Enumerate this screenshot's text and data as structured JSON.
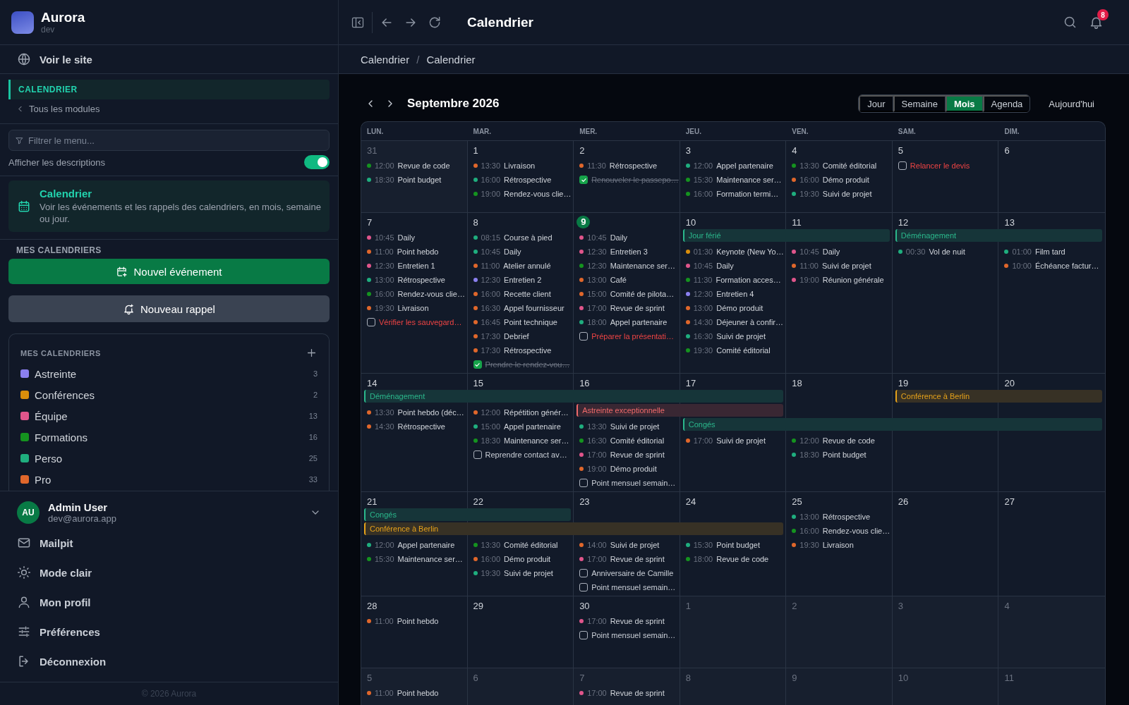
{
  "brand": {
    "name": "Aurora",
    "env": "dev"
  },
  "sidebar": {
    "site_link": "Voir le site",
    "module": "CALENDRIER",
    "back_link": "Tous les modules",
    "filter": {
      "placeholder": "Filtrer le menu..."
    },
    "descriptions_toggle": {
      "label": "Afficher les descriptions",
      "on": true
    },
    "info_card": {
      "title": "Calendrier",
      "text": "Voir les événements et les rappels des calendriers, en mois, semaine ou jour."
    },
    "section_title": "MES CALENDRIERS",
    "buttons": [
      {
        "kind": "primary",
        "label": "Nouvel événement"
      },
      {
        "kind": "secondary",
        "label": "Nouveau rappel"
      }
    ],
    "calendars": {
      "title": "MES CALENDRIERS",
      "items": [
        {
          "name": "Astreinte",
          "count": "3",
          "color": "#8b80f0"
        },
        {
          "name": "Conférences",
          "count": "2",
          "color": "#d98e0b"
        },
        {
          "name": "Équipe",
          "count": "13",
          "color": "#e0558b"
        },
        {
          "name": "Formations",
          "count": "16",
          "color": "#15931f"
        },
        {
          "name": "Perso",
          "count": "25",
          "color": "#1fae7e"
        },
        {
          "name": "Pro",
          "count": "33",
          "color": "#e0672b"
        }
      ]
    },
    "user": {
      "initials": "AU",
      "name": "Admin User",
      "email": "dev@aurora.app"
    },
    "menu": [
      {
        "kind": "mail",
        "label": "Mailpit"
      },
      {
        "kind": "sun",
        "label": "Mode clair"
      },
      {
        "kind": "user",
        "label": "Mon profil"
      },
      {
        "kind": "sliders",
        "label": "Préférences"
      },
      {
        "kind": "logout",
        "label": "Déconnexion"
      }
    ],
    "footer": "© 2026 Aurora"
  },
  "topbar": {
    "title": "Calendrier",
    "notifications": "8"
  },
  "breadcrumb": {
    "items": [
      "Calendrier",
      "Calendrier"
    ],
    "separator": "/"
  },
  "calendar": {
    "month": "Septembre 2026",
    "views": [
      {
        "label": "Jour",
        "selected": false
      },
      {
        "label": "Semaine",
        "selected": false
      },
      {
        "label": "Mois",
        "selected": true
      },
      {
        "label": "Agenda",
        "selected": false
      }
    ],
    "today_button": "Aujourd'hui",
    "weekdays": [
      "LUN.",
      "MAR.",
      "MER.",
      "JEU.",
      "VEN.",
      "SAM.",
      "DIM."
    ],
    "weeks": [
      {
        "days": [
          {
            "num": "31",
            "outside": true,
            "today": false,
            "items": [
              {
                "kind": "event",
                "time": "12:00",
                "title": "Revue de code",
                "color": "#15931f"
              },
              {
                "kind": "event",
                "time": "18:30",
                "title": "Point budget",
                "color": "#1fae7e"
              }
            ]
          },
          {
            "num": "1",
            "outside": false,
            "today": false,
            "items": [
              {
                "kind": "event",
                "time": "13:30",
                "title": "Livraison",
                "color": "#e0672b"
              },
              {
                "kind": "event",
                "time": "16:00",
                "title": "Rétrospective",
                "color": "#1fae7e"
              },
              {
                "kind": "event",
                "time": "19:00",
                "title": "Rendez-vous clie…",
                "color": "#15931f"
              }
            ]
          },
          {
            "num": "2",
            "outside": false,
            "today": false,
            "items": [
              {
                "kind": "event",
                "time": "11:30",
                "title": "Rétrospective",
                "color": "#e0672b"
              },
              {
                "kind": "task",
                "title": "Renouveler le passepo…",
                "checked": true,
                "overdue": false
              }
            ]
          },
          {
            "num": "3",
            "outside": false,
            "today": false,
            "items": [
              {
                "kind": "event",
                "time": "12:00",
                "title": "Appel partenaire",
                "color": "#1fae7e"
              },
              {
                "kind": "event",
                "time": "15:30",
                "title": "Maintenance ser…",
                "color": "#15931f"
              },
              {
                "kind": "event",
                "time": "16:00",
                "title": "Formation termi…",
                "color": "#15931f"
              }
            ]
          },
          {
            "num": "4",
            "outside": false,
            "today": false,
            "items": [
              {
                "kind": "event",
                "time": "13:30",
                "title": "Comité éditorial",
                "color": "#15931f"
              },
              {
                "kind": "event",
                "time": "16:00",
                "title": "Démo produit",
                "color": "#e0672b"
              },
              {
                "kind": "event",
                "time": "19:30",
                "title": "Suivi de projet",
                "color": "#1fae7e"
              }
            ]
          },
          {
            "num": "5",
            "outside": false,
            "today": false,
            "items": [
              {
                "kind": "task",
                "title": "Relancer le devis",
                "checked": false,
                "overdue": true
              }
            ]
          },
          {
            "num": "6",
            "outside": false,
            "today": false
          }
        ]
      },
      {
        "days": [
          {
            "num": "7",
            "outside": false,
            "today": false,
            "items": [
              {
                "kind": "event",
                "time": "10:45",
                "title": "Daily",
                "color": "#e0558b"
              },
              {
                "kind": "event",
                "time": "11:00",
                "title": "Point hebdo",
                "color": "#e0672b"
              },
              {
                "kind": "event",
                "time": "12:30",
                "title": "Entretien 1",
                "color": "#e0558b"
              },
              {
                "kind": "event",
                "time": "13:00",
                "title": "Rétrospective",
                "color": "#1fae7e"
              },
              {
                "kind": "event",
                "time": "16:00",
                "title": "Rendez-vous clie…",
                "color": "#15931f"
              },
              {
                "kind": "event",
                "time": "19:30",
                "title": "Livraison",
                "color": "#e0672b"
              },
              {
                "kind": "task",
                "title": "Vérifier les sauvegard…",
                "checked": false,
                "overdue": true
              }
            ]
          },
          {
            "num": "8",
            "outside": false,
            "today": false,
            "items": [
              {
                "kind": "event",
                "time": "08:15",
                "title": "Course à pied",
                "color": "#1fae7e"
              },
              {
                "kind": "event",
                "time": "10:45",
                "title": "Daily",
                "color": "#1fae7e"
              },
              {
                "kind": "event",
                "time": "11:00",
                "title": "Atelier annulé",
                "color": "#e0672b"
              },
              {
                "kind": "event",
                "time": "12:30",
                "title": "Entretien 2",
                "color": "#8b80f0"
              },
              {
                "kind": "event",
                "time": "16:00",
                "title": "Recette client",
                "color": "#e0672b"
              },
              {
                "kind": "event",
                "time": "16:30",
                "title": "Appel fournisseur",
                "color": "#e0672b"
              },
              {
                "kind": "event",
                "time": "16:45",
                "title": "Point technique",
                "color": "#e0672b"
              },
              {
                "kind": "event",
                "time": "17:30",
                "title": "Debrief",
                "color": "#e0672b"
              },
              {
                "kind": "event",
                "time": "17:30",
                "title": "Rétrospective",
                "color": "#e0672b"
              },
              {
                "kind": "task",
                "title": "Prendre le rendez-vou…",
                "checked": true,
                "overdue": false
              }
            ]
          },
          {
            "num": "9",
            "outside": false,
            "today": true,
            "items": [
              {
                "kind": "event",
                "time": "10:45",
                "title": "Daily",
                "color": "#e0558b"
              },
              {
                "kind": "event",
                "time": "12:30",
                "title": "Entretien 3",
                "color": "#e0558b"
              },
              {
                "kind": "event",
                "time": "12:30",
                "title": "Maintenance ser…",
                "color": "#15931f"
              },
              {
                "kind": "event",
                "time": "13:00",
                "title": "Café",
                "color": "#e0672b"
              },
              {
                "kind": "event",
                "time": "15:00",
                "title": "Comité de pilota…",
                "color": "#e0672b"
              },
              {
                "kind": "event",
                "time": "17:00",
                "title": "Revue de sprint",
                "color": "#e0558b"
              },
              {
                "kind": "event",
                "time": "18:00",
                "title": "Appel partenaire",
                "color": "#1fae7e"
              },
              {
                "kind": "task",
                "title": "Préparer la présentati…",
                "checked": false,
                "overdue": true
              }
            ]
          },
          {
            "num": "10",
            "outside": false,
            "today": false,
            "bars": [
              {
                "kind": "bar",
                "label": "Jour férié",
                "color": "#2bb88c"
              }
            ],
            "items": [
              {
                "kind": "event",
                "time": "01:30",
                "title": "Keynote (New Yo…",
                "color": "#d98e0b"
              },
              {
                "kind": "event",
                "time": "10:45",
                "title": "Daily",
                "color": "#e0558b"
              },
              {
                "kind": "event",
                "time": "11:30",
                "title": "Formation acces…",
                "color": "#15931f"
              },
              {
                "kind": "event",
                "time": "12:30",
                "title": "Entretien 4",
                "color": "#8b80f0"
              },
              {
                "kind": "event",
                "time": "13:00",
                "title": "Démo produit",
                "color": "#e0672b"
              },
              {
                "kind": "event",
                "time": "14:30",
                "title": "Déjeuner à confir…",
                "color": "#e0672b"
              },
              {
                "kind": "event",
                "time": "16:30",
                "title": "Suivi de projet",
                "color": "#1fae7e"
              },
              {
                "kind": "event",
                "time": "19:30",
                "title": "Comité éditorial",
                "color": "#15931f"
              }
            ]
          },
          {
            "num": "11",
            "outside": false,
            "today": false,
            "bars": [
              {
                "kind": "continued"
              }
            ],
            "items": [
              {
                "kind": "event",
                "time": "10:45",
                "title": "Daily",
                "color": "#e0558b"
              },
              {
                "kind": "event",
                "time": "11:00",
                "title": "Suivi de projet",
                "color": "#e0672b"
              },
              {
                "kind": "event",
                "time": "19:00",
                "title": "Réunion générale",
                "color": "#e0558b"
              }
            ]
          },
          {
            "num": "12",
            "outside": false,
            "today": false,
            "bars": [
              {
                "kind": "bar",
                "label": "Déménagement",
                "color": "#2bb88c"
              }
            ],
            "items": [
              {
                "kind": "event",
                "time": "00:30",
                "title": "Vol de nuit",
                "color": "#1fae7e"
              }
            ]
          },
          {
            "num": "13",
            "outside": false,
            "today": false,
            "bars": [
              {
                "kind": "continued"
              }
            ],
            "items": [
              {
                "kind": "event",
                "time": "01:00",
                "title": "Film tard",
                "color": "#1fae7e"
              },
              {
                "kind": "event",
                "time": "10:00",
                "title": "Échéance factur…",
                "color": "#e0672b"
              }
            ]
          }
        ]
      },
      {
        "days": [
          {
            "num": "14",
            "outside": false,
            "today": false,
            "bars": [
              {
                "kind": "bar",
                "label": "Déménagement",
                "color": "#2bb88c"
              }
            ],
            "items": [
              {
                "kind": "event",
                "time": "13:30",
                "title": "Point hebdo (déc…",
                "color": "#e0672b"
              },
              {
                "kind": "event",
                "time": "14:30",
                "title": "Rétrospective",
                "color": "#e0672b"
              }
            ]
          },
          {
            "num": "15",
            "outside": false,
            "today": false,
            "bars": [
              {
                "kind": "continued"
              }
            ],
            "items": [
              {
                "kind": "event",
                "time": "12:00",
                "title": "Répétition génér…",
                "color": "#e0672b"
              },
              {
                "kind": "event",
                "time": "15:00",
                "title": "Appel partenaire",
                "color": "#1fae7e"
              },
              {
                "kind": "event",
                "time": "18:30",
                "title": "Maintenance ser…",
                "color": "#15931f"
              },
              {
                "kind": "task",
                "title": "Reprendre contact av…",
                "checked": false,
                "overdue": false
              }
            ]
          },
          {
            "num": "16",
            "outside": false,
            "today": false,
            "bars": [
              {
                "kind": "continued"
              },
              {
                "kind": "bar",
                "label": "Astreinte exceptionnelle",
                "color": "#f06a6a"
              }
            ],
            "items": [
              {
                "kind": "event",
                "time": "13:30",
                "title": "Suivi de projet",
                "color": "#1fae7e"
              },
              {
                "kind": "event",
                "time": "16:30",
                "title": "Comité éditorial",
                "color": "#15931f"
              },
              {
                "kind": "event",
                "time": "17:00",
                "title": "Revue de sprint",
                "color": "#e0558b"
              },
              {
                "kind": "event",
                "time": "19:00",
                "title": "Démo produit",
                "color": "#e0672b"
              },
              {
                "kind": "task",
                "title": "Point mensuel semain…",
                "checked": false,
                "overdue": false
              }
            ]
          },
          {
            "num": "17",
            "outside": false,
            "today": false,
            "bars": [
              {
                "kind": "continued"
              },
              {
                "kind": "continued"
              },
              {
                "kind": "bar",
                "label": "Congés",
                "color": "#2bb88c"
              }
            ],
            "items": [
              {
                "kind": "event",
                "time": "17:00",
                "title": "Suivi de projet",
                "color": "#e0672b"
              }
            ]
          },
          {
            "num": "18",
            "outside": false,
            "today": false,
            "bars": [
              {
                "kind": "gap"
              },
              {
                "kind": "gap"
              },
              {
                "kind": "continued"
              }
            ],
            "items": [
              {
                "kind": "event",
                "time": "12:00",
                "title": "Revue de code",
                "color": "#15931f"
              },
              {
                "kind": "event",
                "time": "18:30",
                "title": "Point budget",
                "color": "#1fae7e"
              }
            ]
          },
          {
            "num": "19",
            "outside": false,
            "today": false,
            "bars": [
              {
                "kind": "bar",
                "label": "Conférence à Berlin",
                "color": "#e6a21a"
              },
              {
                "kind": "gap"
              },
              {
                "kind": "continued"
              }
            ]
          },
          {
            "num": "20",
            "outside": false,
            "today": false,
            "bars": [
              {
                "kind": "continued"
              },
              {
                "kind": "gap"
              },
              {
                "kind": "continued"
              }
            ]
          }
        ]
      },
      {
        "days": [
          {
            "num": "21",
            "outside": false,
            "today": false,
            "bars": [
              {
                "kind": "bar",
                "label": "Congés",
                "color": "#2bb88c"
              },
              {
                "kind": "bar",
                "label": "Conférence à Berlin",
                "color": "#e6a21a"
              }
            ],
            "items": [
              {
                "kind": "event",
                "time": "12:00",
                "title": "Appel partenaire",
                "color": "#1fae7e"
              },
              {
                "kind": "event",
                "time": "15:30",
                "title": "Maintenance ser…",
                "color": "#15931f"
              }
            ]
          },
          {
            "num": "22",
            "outside": false,
            "today": false,
            "bars": [
              {
                "kind": "continued"
              },
              {
                "kind": "continued"
              }
            ],
            "items": [
              {
                "kind": "event",
                "time": "13:30",
                "title": "Comité éditorial",
                "color": "#15931f"
              },
              {
                "kind": "event",
                "time": "16:00",
                "title": "Démo produit",
                "color": "#e0672b"
              },
              {
                "kind": "event",
                "time": "19:30",
                "title": "Suivi de projet",
                "color": "#1fae7e"
              }
            ]
          },
          {
            "num": "23",
            "outside": false,
            "today": false,
            "bars": [
              {
                "kind": "gap"
              },
              {
                "kind": "continued"
              }
            ],
            "items": [
              {
                "kind": "event",
                "time": "14:00",
                "title": "Suivi de projet",
                "color": "#e0672b"
              },
              {
                "kind": "event",
                "time": "17:00",
                "title": "Revue de sprint",
                "color": "#e0558b"
              },
              {
                "kind": "task",
                "title": "Anniversaire de Camille",
                "checked": false,
                "overdue": false
              },
              {
                "kind": "task",
                "title": "Point mensuel semain…",
                "checked": false,
                "overdue": false
              }
            ]
          },
          {
            "num": "24",
            "outside": false,
            "today": false,
            "bars": [
              {
                "kind": "gap"
              },
              {
                "kind": "continued"
              }
            ],
            "items": [
              {
                "kind": "event",
                "time": "15:30",
                "title": "Point budget",
                "color": "#1fae7e"
              },
              {
                "kind": "event",
                "time": "18:00",
                "title": "Revue de code",
                "color": "#15931f"
              }
            ]
          },
          {
            "num": "25",
            "outside": false,
            "today": false,
            "items": [
              {
                "kind": "event",
                "time": "13:00",
                "title": "Rétrospective",
                "color": "#1fae7e"
              },
              {
                "kind": "event",
                "time": "16:00",
                "title": "Rendez-vous clie…",
                "color": "#15931f"
              },
              {
                "kind": "event",
                "time": "19:30",
                "title": "Livraison",
                "color": "#e0672b"
              }
            ]
          },
          {
            "num": "26",
            "outside": false,
            "today": false
          },
          {
            "num": "27",
            "outside": false,
            "today": false
          }
        ]
      },
      {
        "days": [
          {
            "num": "28",
            "outside": false,
            "today": false,
            "items": [
              {
                "kind": "event",
                "time": "11:00",
                "title": "Point hebdo",
                "color": "#e0672b"
              }
            ]
          },
          {
            "num": "29",
            "outside": false,
            "today": false
          },
          {
            "num": "30",
            "outside": false,
            "today": false,
            "items": [
              {
                "kind": "event",
                "time": "17:00",
                "title": "Revue de sprint",
                "color": "#e0558b"
              },
              {
                "kind": "task",
                "title": "Point mensuel semain…",
                "checked": false,
                "overdue": false
              }
            ]
          },
          {
            "num": "1",
            "outside": true,
            "today": false
          },
          {
            "num": "2",
            "outside": true,
            "today": false
          },
          {
            "num": "3",
            "outside": true,
            "today": false
          },
          {
            "num": "4",
            "outside": true,
            "today": false
          }
        ]
      },
      {
        "days": [
          {
            "num": "5",
            "outside": true,
            "today": false,
            "items": [
              {
                "kind": "event",
                "time": "11:00",
                "title": "Point hebdo",
                "color": "#e0672b"
              }
            ]
          },
          {
            "num": "6",
            "outside": true,
            "today": false
          },
          {
            "num": "7",
            "outside": true,
            "today": false,
            "items": [
              {
                "kind": "event",
                "time": "17:00",
                "title": "Revue de sprint",
                "color": "#e0558b"
              }
            ]
          },
          {
            "num": "8",
            "outside": true,
            "today": false
          },
          {
            "num": "9",
            "outside": true,
            "today": false
          },
          {
            "num": "10",
            "outside": true,
            "today": false
          },
          {
            "num": "11",
            "outside": true,
            "today": false
          }
        ]
      }
    ]
  }
}
